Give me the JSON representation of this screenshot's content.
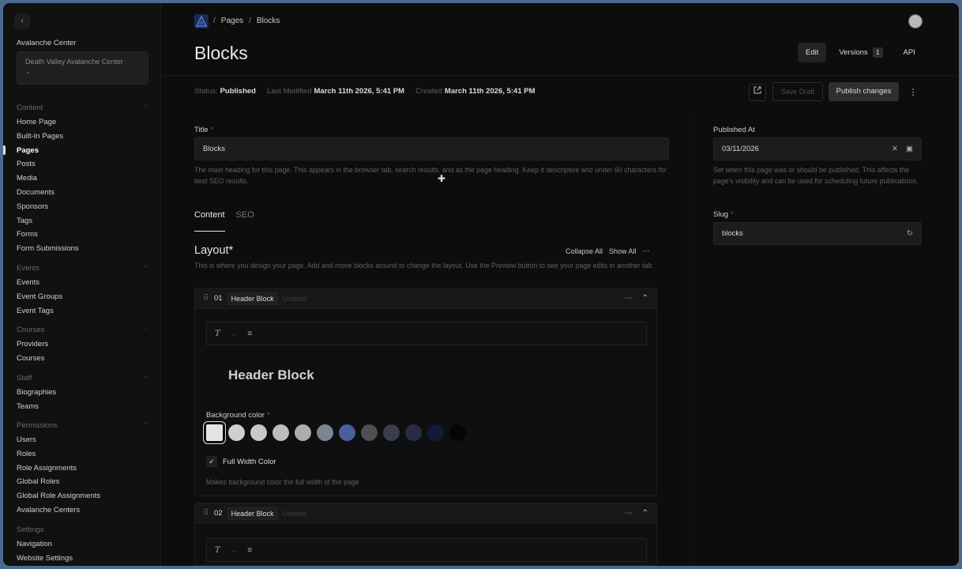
{
  "sidebar": {
    "back_icon": "chevron-left-icon",
    "tenant_label": "Avalanche Center",
    "tenant_value": "Death Valley Avalanche Center",
    "groups": [
      {
        "title": "Content",
        "items": [
          "Home Page",
          "Built-In Pages",
          "Pages",
          "Posts",
          "Media",
          "Documents",
          "Sponsors",
          "Tags",
          "Forms",
          "Form Submissions"
        ]
      },
      {
        "title": "Events",
        "items": [
          "Events",
          "Event Groups",
          "Event Tags"
        ]
      },
      {
        "title": "Courses",
        "items": [
          "Providers",
          "Courses"
        ]
      },
      {
        "title": "Staff",
        "items": [
          "Biographies",
          "Teams"
        ]
      },
      {
        "title": "Permissions",
        "items": [
          "Users",
          "Roles",
          "Role Assignments",
          "Global Roles",
          "Global Role Assignments",
          "Avalanche Centers"
        ]
      },
      {
        "title": "Settings",
        "items": [
          "Navigation",
          "Website Settings"
        ]
      }
    ],
    "active_item": "Pages"
  },
  "header": {
    "breadcrumbs": [
      "Pages",
      "Blocks"
    ],
    "title": "Blocks",
    "tabs": {
      "edit": "Edit",
      "versions": "Versions",
      "versions_count": "1",
      "api": "API"
    }
  },
  "status": {
    "status_key": "Status:",
    "status_value": "Published",
    "modified_key": "Last Modified",
    "modified_value": "March 11th 2026, 5:41 PM",
    "created_key": "Created",
    "created_value": "March 11th 2026, 5:41 PM",
    "save_draft": "Save Draft",
    "publish": "Publish changes"
  },
  "form": {
    "title_label": "Title",
    "title_value": "Blocks",
    "title_help": "The main heading for this page. This appears in the browser tab, search results, and as the page heading. Keep it descriptive and under 60 characters for best SEO results.",
    "tabs": [
      "Content",
      "SEO"
    ],
    "layout_title": "Layout*",
    "layout_help": "This is where you design your page. Add and move blocks around to change the layout. Use the Preview button to see your page edits in another tab.",
    "collapse_all": "Collapse All",
    "show_all": "Show All"
  },
  "blocks": [
    {
      "num": "01",
      "type": "Header Block",
      "status": "Untitled",
      "heading": "Header Block",
      "bg_label": "Background color",
      "full_width": "Full Width Color",
      "full_width_help": "Makes background color the full width of the page"
    },
    {
      "num": "02",
      "type": "Header Block",
      "status": "Untitled"
    }
  ],
  "swatch_colors": [
    "#e4e4e4",
    "#cfcfcf",
    "#c8c8c8",
    "#bdbdbd",
    "#adadad",
    "#7d8595",
    "#4a5f9c",
    "#4d4f57",
    "#3a3d4d",
    "#262c47",
    "#121a38",
    "#050505"
  ],
  "right": {
    "published_label": "Published At",
    "published_value": "03/11/2026",
    "published_help": "Set when this page was or should be published. This affects the page's visibility and can be used for scheduling future publications.",
    "slug_label": "Slug",
    "slug_value": "blocks"
  }
}
